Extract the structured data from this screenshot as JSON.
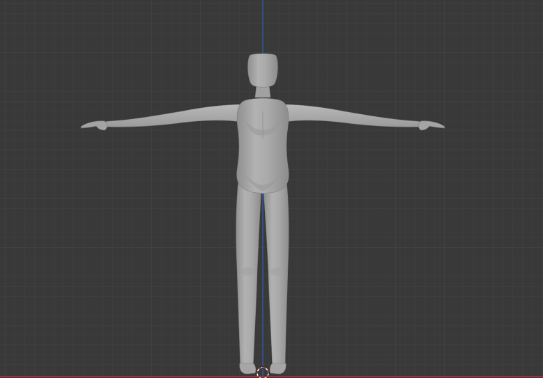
{
  "viewport": {
    "background_color": "#393939",
    "grid_minor_color": "#404040",
    "grid_major_color": "#474747",
    "axis_z_color": "#2f5fb8",
    "axis_x_color": "#b02a3c",
    "view": "front-orthographic",
    "show_grid": true
  },
  "scene": {
    "object": "humanoid-base-mesh",
    "pose": "t-pose",
    "mesh_color": "#a9a9a9",
    "mesh_shadow_color": "#8e8e8e",
    "mesh_highlight_color": "#bcbcbc"
  },
  "cursor": {
    "icon": "3d-cursor-icon",
    "ring_color": "#ffffff",
    "ring_accent_color": "#c0392b"
  }
}
